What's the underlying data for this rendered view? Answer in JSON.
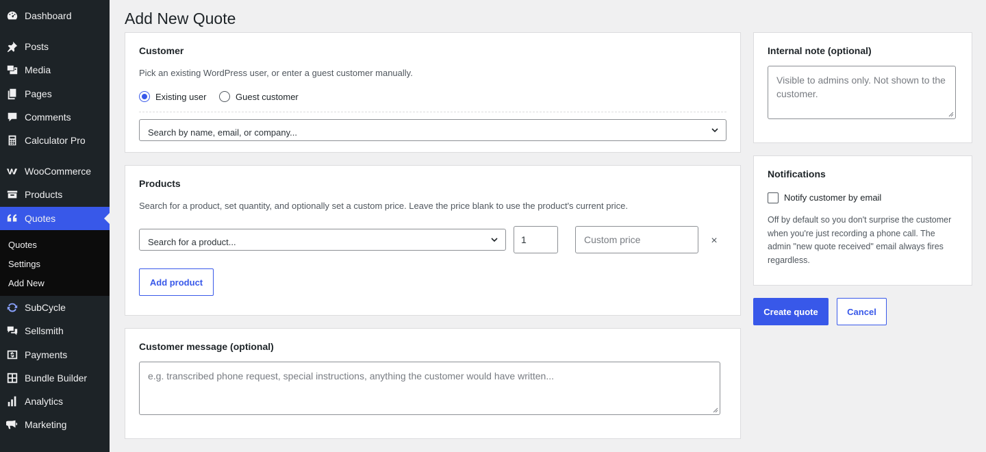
{
  "page": {
    "title": "Add New Quote"
  },
  "sidebar": {
    "items": [
      {
        "label": "Dashboard",
        "icon": "dashboard-icon"
      },
      {
        "label": "Posts",
        "icon": "pin-icon"
      },
      {
        "label": "Media",
        "icon": "media-icon"
      },
      {
        "label": "Pages",
        "icon": "pages-icon"
      },
      {
        "label": "Comments",
        "icon": "comment-icon"
      },
      {
        "label": "Calculator Pro",
        "icon": "calculator-icon"
      },
      {
        "label": "WooCommerce",
        "icon": "woo-icon"
      },
      {
        "label": "Products",
        "icon": "archive-icon"
      },
      {
        "label": "Quotes",
        "icon": "quote-icon",
        "active": true
      },
      {
        "label": "SubCycle",
        "icon": "cycle-icon"
      },
      {
        "label": "Sellsmith",
        "icon": "chat-icon"
      },
      {
        "label": "Payments",
        "icon": "payments-icon"
      },
      {
        "label": "Bundle Builder",
        "icon": "grid-icon"
      },
      {
        "label": "Analytics",
        "icon": "chart-icon"
      },
      {
        "label": "Marketing",
        "icon": "megaphone-icon"
      }
    ],
    "submenu": [
      "Quotes",
      "Settings",
      "Add New"
    ]
  },
  "customer": {
    "title": "Customer",
    "help": "Pick an existing WordPress user, or enter a guest customer manually.",
    "radio_existing": "Existing user",
    "radio_guest": "Guest customer",
    "selected": "Existing user",
    "search_placeholder": "Search by name, email, or company..."
  },
  "products": {
    "title": "Products",
    "help": "Search for a product, set quantity, and optionally set a custom price. Leave the price blank to use the product's current price.",
    "product_placeholder": "Search for a product...",
    "quantity": "1",
    "price_placeholder": "Custom price",
    "remove_symbol": "×",
    "add_button": "Add product"
  },
  "message": {
    "title": "Customer message (optional)",
    "placeholder": "e.g. transcribed phone request, special instructions, anything the customer would have written..."
  },
  "internal_note": {
    "title": "Internal note (optional)",
    "placeholder": "Visible to admins only. Not shown to the customer."
  },
  "notifications": {
    "title": "Notifications",
    "checkbox_label": "Notify customer by email",
    "checked": false,
    "help": "Off by default so you don't surprise the customer when you're just recording a phone call. The admin \"new quote received\" email always fires regardless."
  },
  "actions": {
    "create": "Create quote",
    "cancel": "Cancel"
  },
  "colors": {
    "accent": "#3858e9",
    "sidebar_bg": "#1d2327",
    "submenu_bg": "#0c0c0c",
    "page_bg": "#f0f0f1"
  }
}
